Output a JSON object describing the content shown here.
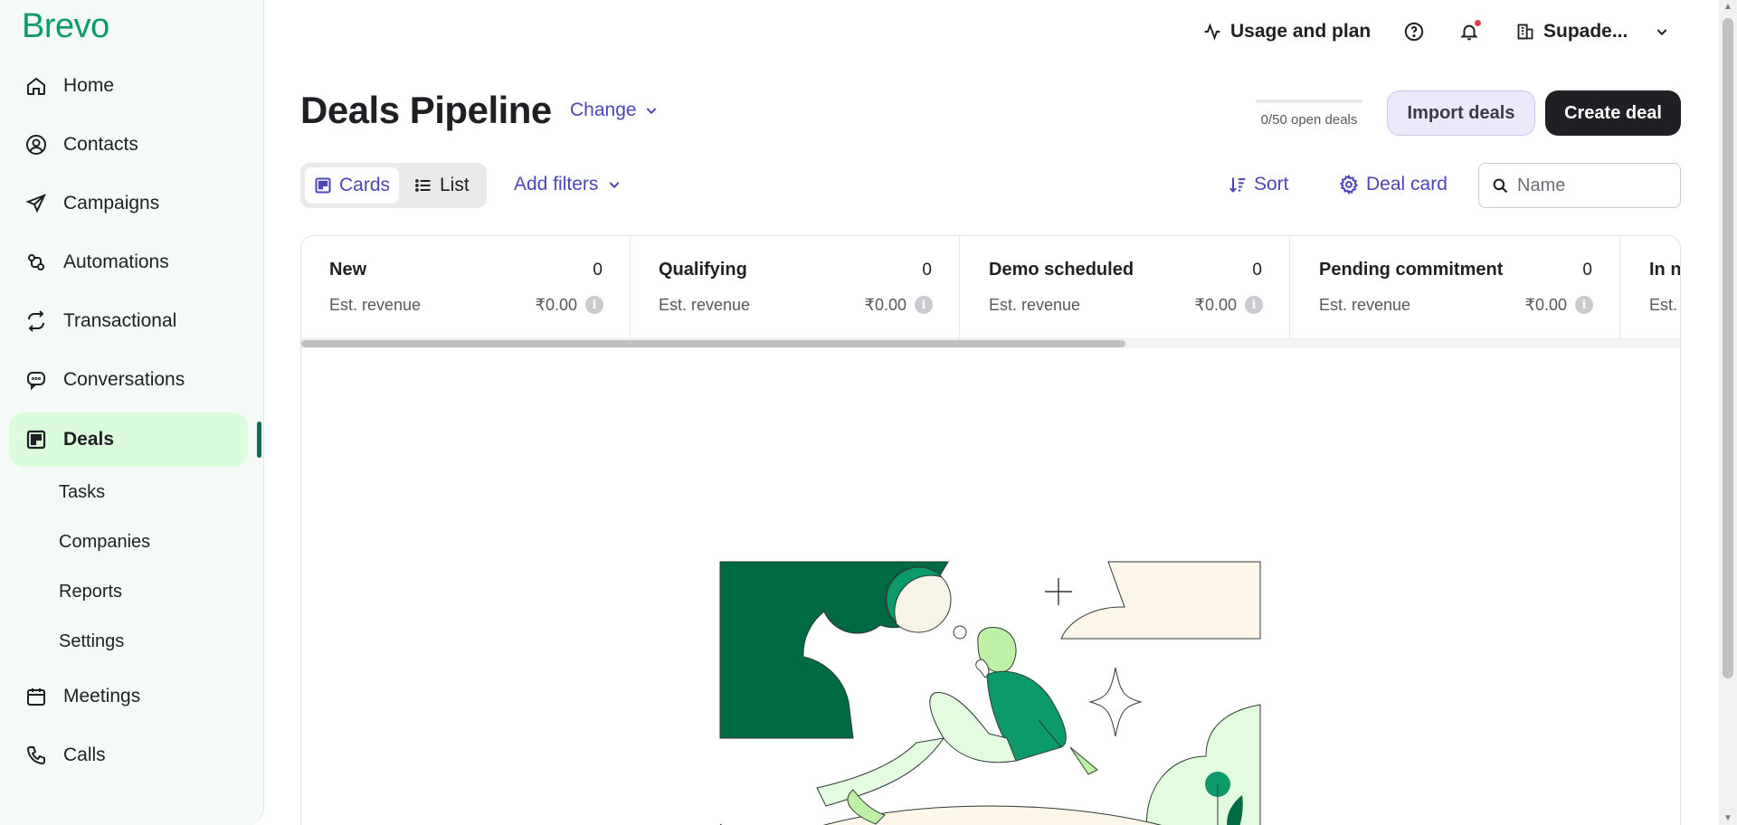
{
  "brand": {
    "logo": "Brevo",
    "accent": "#0b996e",
    "link_color": "#4c46b8"
  },
  "sidebar": {
    "items": [
      {
        "label": "Home",
        "icon": "home-icon"
      },
      {
        "label": "Contacts",
        "icon": "contacts-icon"
      },
      {
        "label": "Campaigns",
        "icon": "send-icon"
      },
      {
        "label": "Automations",
        "icon": "automations-icon"
      },
      {
        "label": "Transactional",
        "icon": "repeat-icon"
      },
      {
        "label": "Conversations",
        "icon": "chat-icon"
      },
      {
        "label": "Deals",
        "icon": "deals-icon",
        "active": true
      },
      {
        "label": "Meetings",
        "icon": "calendar-icon"
      },
      {
        "label": "Calls",
        "icon": "phone-icon"
      }
    ],
    "deals_sub": [
      "Tasks",
      "Companies",
      "Reports",
      "Settings"
    ]
  },
  "topbar": {
    "usage": "Usage and plan",
    "account": "Supade..."
  },
  "header": {
    "title": "Deals Pipeline",
    "change": "Change",
    "open_deals": "0/50 open deals",
    "open_deals_fraction": 0,
    "import": "Import deals",
    "create": "Create deal"
  },
  "toolbar": {
    "cards": "Cards",
    "list": "List",
    "add_filters": "Add filters",
    "sort": "Sort",
    "deal_card": "Deal card",
    "search_placeholder": "Name"
  },
  "stages": [
    {
      "name": "New",
      "count": "0",
      "rev_label": "Est. revenue",
      "rev": "₹0.00"
    },
    {
      "name": "Qualifying",
      "count": "0",
      "rev_label": "Est. revenue",
      "rev": "₹0.00"
    },
    {
      "name": "Demo scheduled",
      "count": "0",
      "rev_label": "Est. revenue",
      "rev": "₹0.00"
    },
    {
      "name": "Pending commitment",
      "count": "0",
      "rev_label": "Est. revenue",
      "rev": "₹0.00"
    },
    {
      "name": "In n",
      "count": "",
      "rev_label": "Est. ",
      "rev": ""
    }
  ]
}
